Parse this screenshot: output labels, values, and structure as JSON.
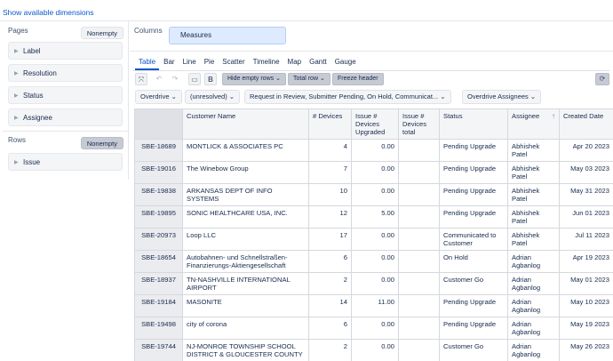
{
  "top": {
    "show_dimensions": "Show available dimensions"
  },
  "pages": {
    "title": "Pages",
    "nonempty": "Nonempty",
    "items": [
      "Label",
      "Resolution",
      "Status",
      "Assignee"
    ]
  },
  "rows": {
    "title": "Rows",
    "nonempty": "Nonempty",
    "items": [
      "Issue"
    ]
  },
  "columns": {
    "title": "Columns",
    "measures": "Measures"
  },
  "tabs": [
    "Table",
    "Bar",
    "Line",
    "Pie",
    "Scatter",
    "Timeline",
    "Map",
    "Gantt",
    "Gauge"
  ],
  "toolbar": {
    "hide_empty_rows": "Hide empty rows",
    "total_row": "Total row",
    "freeze_header": "Freeze header"
  },
  "filters": {
    "f1": "Overdrive",
    "f2": "(unresolved)",
    "f3": "Request in Review, Submitter Pending, On Hold, Communicat...",
    "f4": "Overdrive Assignees"
  },
  "table": {
    "headers": [
      "Customer Name",
      "# Devices",
      "Issue # Devices Upgraded",
      "Issue # Devices total",
      "Status",
      "Assignee",
      "Created Date"
    ],
    "rows": [
      {
        "issue": "SBE-18689",
        "customer": "MONTLICK & ASSOCIATES PC",
        "devices": "4",
        "upgraded": "0.00",
        "total": "",
        "status": "Pending Upgrade",
        "assignee": "Abhishek Patel",
        "created": "Apr 20 2023"
      },
      {
        "issue": "SBE-19016",
        "customer": "The Winebow Group",
        "devices": "7",
        "upgraded": "0.00",
        "total": "",
        "status": "Pending Upgrade",
        "assignee": "Abhishek Patel",
        "created": "May 03 2023"
      },
      {
        "issue": "SBE-19838",
        "customer": "ARKANSAS DEPT OF INFO SYSTEMS",
        "devices": "10",
        "upgraded": "0.00",
        "total": "",
        "status": "Pending Upgrade",
        "assignee": "Abhishek Patel",
        "created": "May 31 2023"
      },
      {
        "issue": "SBE-19895",
        "customer": "SONIC HEALTHCARE USA, INC.",
        "devices": "12",
        "upgraded": "5.00",
        "total": "",
        "status": "Pending Upgrade",
        "assignee": "Abhishek Patel",
        "created": "Jun 01 2023"
      },
      {
        "issue": "SBE-20973",
        "customer": "Loop LLC",
        "devices": "17",
        "upgraded": "0.00",
        "total": "",
        "status": "Communicated to Customer",
        "assignee": "Abhishek Patel",
        "created": "Jul 11 2023"
      },
      {
        "issue": "SBE-18654",
        "customer": "Autobahnen- und Schnellstraßen-Finanzierungs-Aktiengesellschaft",
        "devices": "6",
        "upgraded": "0.00",
        "total": "",
        "status": "On Hold",
        "assignee": "Adrian Agbanlog",
        "created": "Apr 19 2023"
      },
      {
        "issue": "SBE-18937",
        "customer": "TN-NASHVILLE INTERNATIONAL AIRPORT",
        "devices": "2",
        "upgraded": "0.00",
        "total": "",
        "status": "Customer Go",
        "assignee": "Adrian Agbanlog",
        "created": "May 01 2023"
      },
      {
        "issue": "SBE-19184",
        "customer": "MASONITE",
        "devices": "14",
        "upgraded": "11.00",
        "total": "",
        "status": "Pending Upgrade",
        "assignee": "Adrian Agbanlog",
        "created": "May 10 2023"
      },
      {
        "issue": "SBE-19498",
        "customer": "city of corona",
        "devices": "6",
        "upgraded": "0.00",
        "total": "",
        "status": "Pending Upgrade",
        "assignee": "Adrian Agbanlog",
        "created": "May 19 2023"
      },
      {
        "issue": "SBE-19744",
        "customer": "NJ-MONROE TOWNSHIP SCHOOL DISTRICT & GLOUCESTER COUNTY",
        "devices": "2",
        "upgraded": "0.00",
        "total": "",
        "status": "Customer Go",
        "assignee": "Adrian Agbanlog",
        "created": "May 26 2023"
      }
    ]
  },
  "icons": {
    "expand": "expand-icon",
    "undo": "undo-icon",
    "redo": "redo-icon",
    "comment": "comment-icon",
    "bold": "bold-icon",
    "refresh": "refresh-icon",
    "sort": "sort-ascending-icon"
  }
}
